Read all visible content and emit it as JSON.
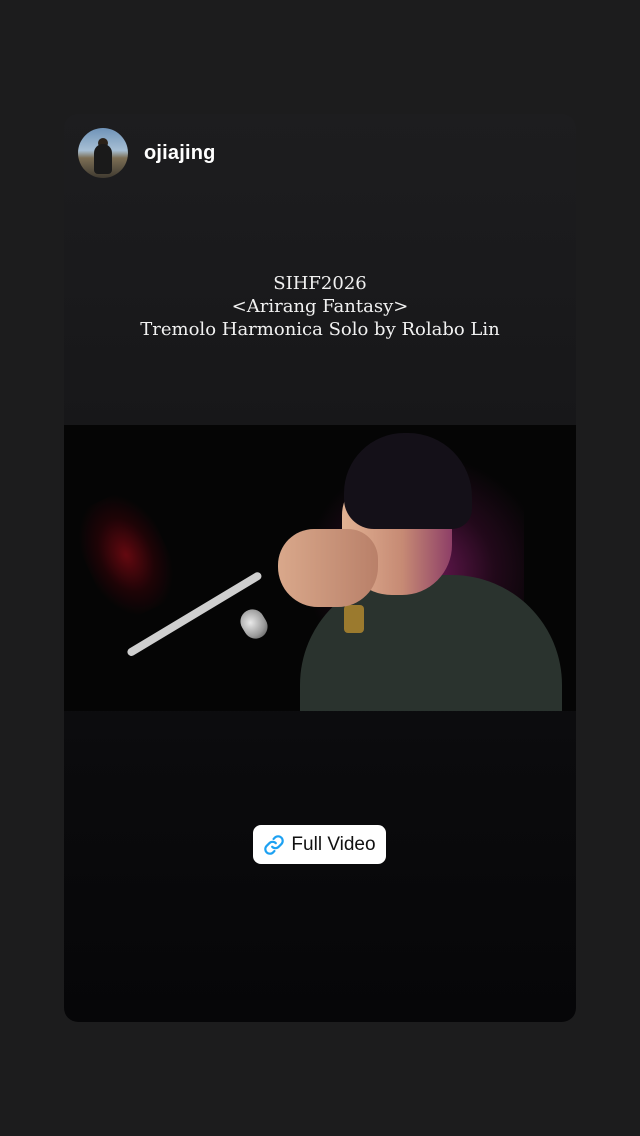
{
  "story": {
    "username": "ojiajing",
    "caption_lines": [
      "SIHF2026",
      "<Arirang Fantasy>",
      "Tremolo Harmonica Solo by Rolabo Lin"
    ],
    "cta": {
      "label": "Full Video",
      "icon": "link-icon",
      "icon_color": "#1da1f2"
    }
  },
  "colors": {
    "background": "#1c1c1d",
    "card": "#161618",
    "text": "#ffffff"
  }
}
